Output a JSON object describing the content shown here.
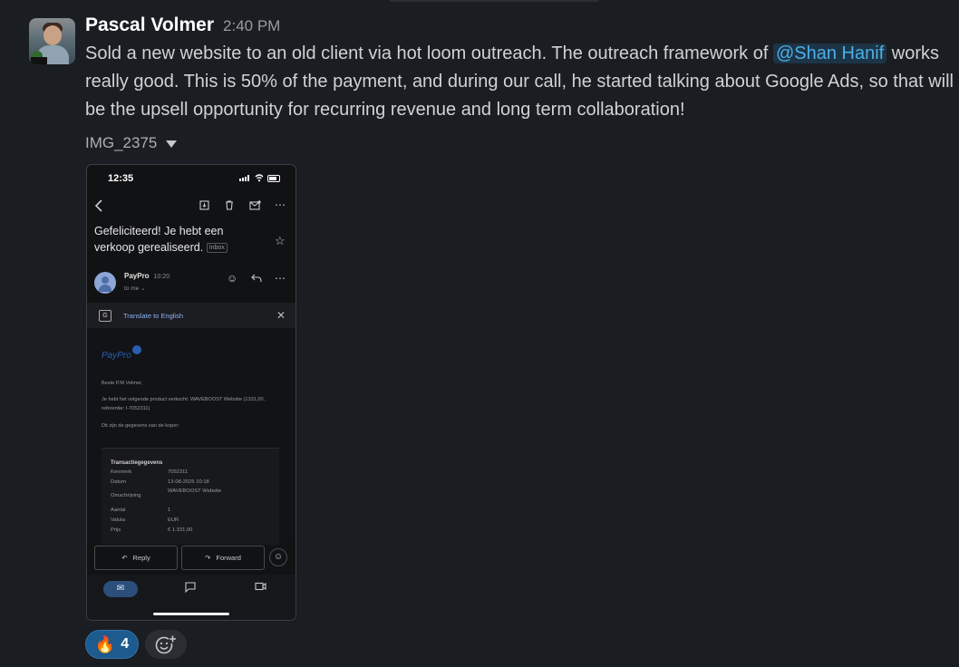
{
  "message": {
    "author": "Pascal Volmer",
    "time": "2:40 PM",
    "text_before": "Sold a new website to an old client via hot loom outreach. The outreach framework of ",
    "mention": "@Shan Hanif",
    "text_after": " works really good. This is 50% of the payment, and during our call, he started talking about Google Ads, so that will be the upsell opportunity for recurring revenue and long term collaboration!",
    "attachment_name": "IMG_2375"
  },
  "phone": {
    "status_time": "12:35",
    "subject": "Gefeliciteerd! Je hebt een verkoop gerealiseerd.",
    "inbox_chip": "Inbox",
    "sender": "PayPro",
    "sender_time": "10:20",
    "to_line": "to me",
    "translate_label": "Translate to English",
    "logo_text": "PayPro",
    "greeting": "Beste P.M Volmer,",
    "line1": "Je hebt het volgende product verkocht: WAVEBOOST Website (1331,00 , referentie: I-7052311)",
    "line2": "Dit zijn de gegevens van de koper:",
    "tx_title": "Transactiegegevens",
    "tx": [
      {
        "k": "Kenmerk",
        "v": "7052311"
      },
      {
        "k": "Datum",
        "v": "13-08-2025 10:18"
      },
      {
        "k": "Omschrijving",
        "v": "WAVEBOOST Website"
      },
      {
        "k": "Aantal",
        "v": "1"
      },
      {
        "k": "Valuta",
        "v": "EUR"
      },
      {
        "k": "Prijs",
        "v": "€ 1.331,00"
      }
    ],
    "reply_label": "Reply",
    "forward_label": "Forward"
  },
  "reactions": {
    "fire_emoji": "🔥",
    "fire_count": "4"
  },
  "icons": [
    "back-icon",
    "archive-icon",
    "trash-icon",
    "mark-unread-icon",
    "more-icon",
    "star-icon",
    "smiley-icon",
    "reply-icon",
    "close-icon",
    "mail-icon",
    "chat-icon",
    "video-icon",
    "add-reaction-icon"
  ]
}
